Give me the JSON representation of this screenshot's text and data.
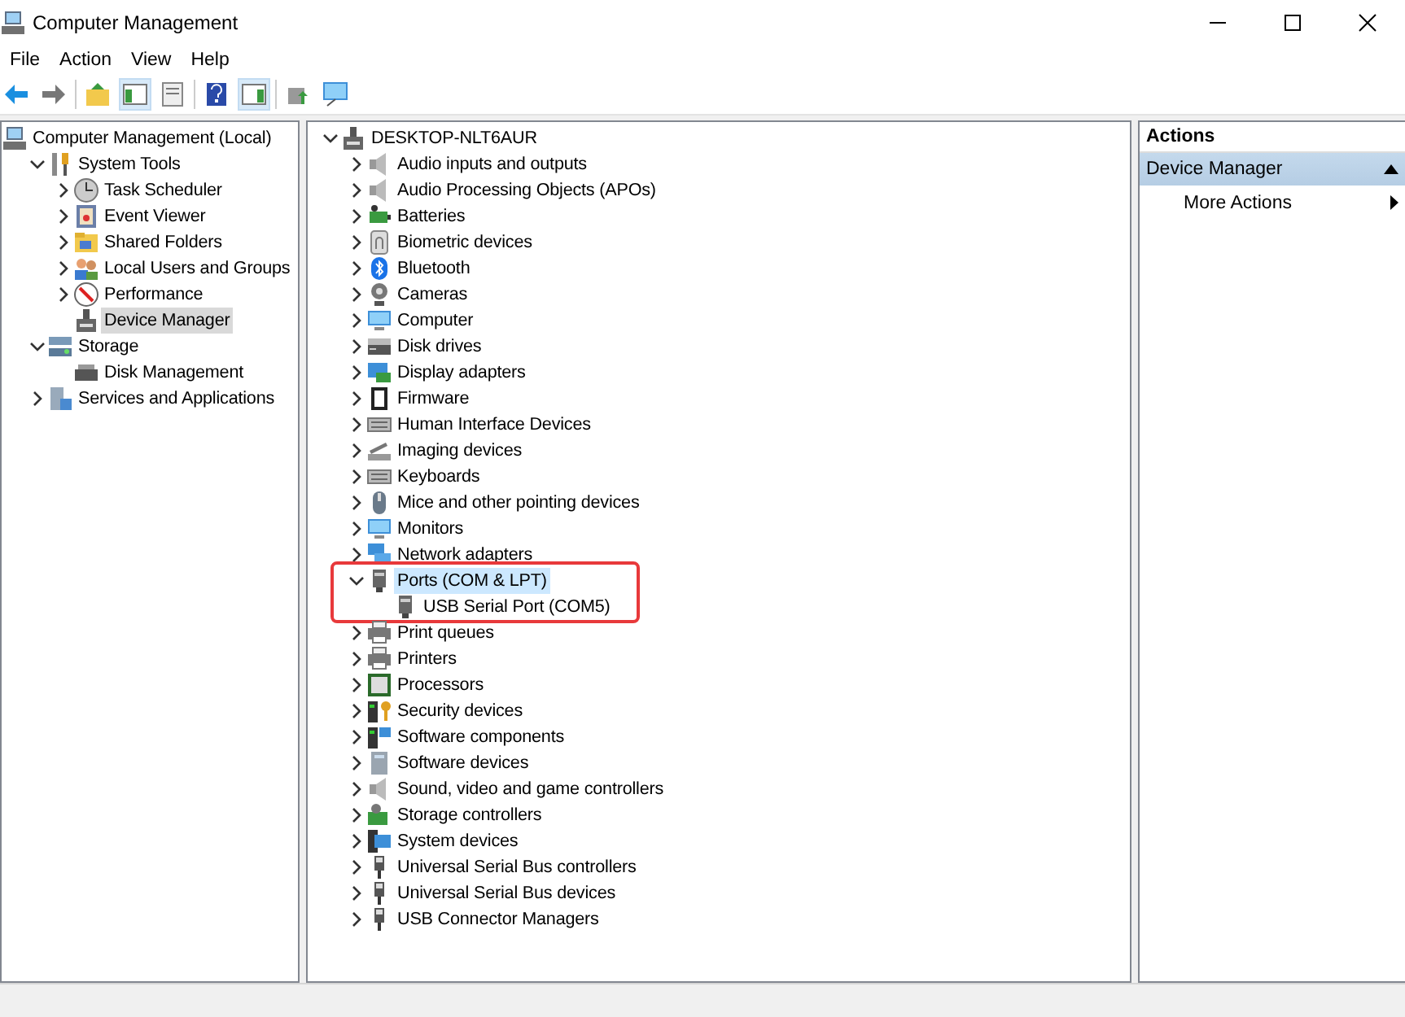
{
  "window": {
    "title": "Computer Management"
  },
  "menu": [
    "File",
    "Action",
    "View",
    "Help"
  ],
  "toolbar": [
    {
      "pressed": false
    },
    {
      "pressed": false
    },
    {
      "pressed": false
    },
    {
      "pressed": true
    },
    {
      "pressed": false
    },
    {
      "pressed": false
    },
    {
      "pressed": true
    },
    {
      "pressed": false
    },
    {
      "pressed": false
    }
  ],
  "console_tree": [
    {
      "label": "Computer Management (Local)",
      "selected": false,
      "children": [
        {
          "label": "System Tools",
          "expanded": true,
          "selected": false,
          "children": [
            {
              "label": "Task Scheduler",
              "expanded": false,
              "selected": false
            },
            {
              "label": "Event Viewer",
              "expanded": false,
              "selected": false
            },
            {
              "label": "Shared Folders",
              "expanded": false,
              "selected": false
            },
            {
              "label": "Local Users and Groups",
              "expanded": false,
              "selected": false
            },
            {
              "label": "Performance",
              "expanded": false,
              "selected": false
            },
            {
              "label": "Device Manager",
              "selected": true
            }
          ]
        },
        {
          "label": "Storage",
          "expanded": true,
          "selected": false,
          "children": [
            {
              "label": "Disk Management",
              "selected": false
            }
          ]
        },
        {
          "label": "Services and Applications",
          "expanded": false,
          "selected": false
        }
      ]
    }
  ],
  "device_tree": [
    {
      "label": "DESKTOP-NLT6AUR",
      "expanded": true,
      "selected": false,
      "children": [
        {
          "label": "Audio inputs and outputs",
          "expanded": false,
          "selected": false
        },
        {
          "label": "Audio Processing Objects (APOs)",
          "expanded": false,
          "selected": false
        },
        {
          "label": "Batteries",
          "expanded": false,
          "selected": false
        },
        {
          "label": "Biometric devices",
          "expanded": false,
          "selected": false
        },
        {
          "label": "Bluetooth",
          "expanded": false,
          "selected": false
        },
        {
          "label": "Cameras",
          "expanded": false,
          "selected": false
        },
        {
          "label": "Computer",
          "expanded": false,
          "selected": false
        },
        {
          "label": "Disk drives",
          "expanded": false,
          "selected": false
        },
        {
          "label": "Display adapters",
          "expanded": false,
          "selected": false
        },
        {
          "label": "Firmware",
          "expanded": false,
          "selected": false
        },
        {
          "label": "Human Interface Devices",
          "expanded": false,
          "selected": false
        },
        {
          "label": "Imaging devices",
          "expanded": false,
          "selected": false
        },
        {
          "label": "Keyboards",
          "expanded": false,
          "selected": false
        },
        {
          "label": "Mice and other pointing devices",
          "expanded": false,
          "selected": false
        },
        {
          "label": "Monitors",
          "expanded": false,
          "selected": false
        },
        {
          "label": "Network adapters",
          "expanded": false,
          "selected": false
        },
        {
          "label": "Ports (COM & LPT)",
          "expanded": true,
          "selected": true,
          "annotated": true,
          "children": [
            {
              "label": "USB Serial Port (COM5)",
              "selected": false
            }
          ]
        },
        {
          "label": "Print queues",
          "expanded": false,
          "selected": false
        },
        {
          "label": "Printers",
          "expanded": false,
          "selected": false
        },
        {
          "label": "Processors",
          "expanded": false,
          "selected": false
        },
        {
          "label": "Security devices",
          "expanded": false,
          "selected": false
        },
        {
          "label": "Software components",
          "expanded": false,
          "selected": false
        },
        {
          "label": "Software devices",
          "expanded": false,
          "selected": false
        },
        {
          "label": "Sound, video and game controllers",
          "expanded": false,
          "selected": false
        },
        {
          "label": "Storage controllers",
          "expanded": false,
          "selected": false
        },
        {
          "label": "System devices",
          "expanded": false,
          "selected": false
        },
        {
          "label": "Universal Serial Bus controllers",
          "expanded": false,
          "selected": false
        },
        {
          "label": "Universal Serial Bus devices",
          "expanded": false,
          "selected": false
        },
        {
          "label": "USB Connector Managers",
          "expanded": false,
          "selected": false
        }
      ]
    }
  ],
  "actions": {
    "title": "Actions",
    "section": {
      "label": "Device Manager",
      "expanded": true
    },
    "items": [
      "More Actions"
    ]
  }
}
